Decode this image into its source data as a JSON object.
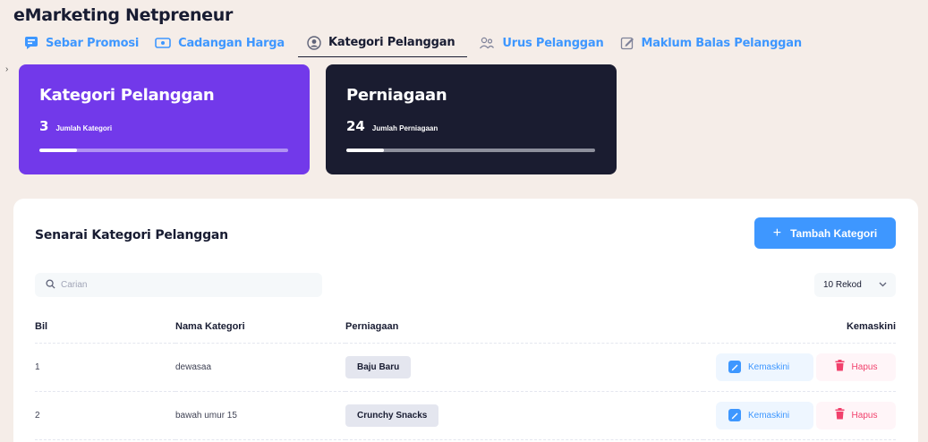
{
  "app": {
    "title": "eMarketing Netpreneur"
  },
  "nav": {
    "items": [
      {
        "label": "Sebar Promosi",
        "icon": "message-icon",
        "active": false
      },
      {
        "label": "Cadangan Harga",
        "icon": "cash-icon",
        "active": false
      },
      {
        "label": "Kategori Pelanggan",
        "icon": "user-circle-icon",
        "active": true
      },
      {
        "label": "Urus Pelanggan",
        "icon": "users-icon",
        "active": false
      },
      {
        "label": "Maklum Balas Pelanggan",
        "icon": "pencil-square-icon",
        "active": false
      }
    ]
  },
  "stats": [
    {
      "title": "Kategori Pelanggan",
      "number": "3",
      "label": "Jumlah Kategori",
      "progress_fraction": 0.15,
      "color": "#7239ea"
    },
    {
      "title": "Perniagaan",
      "number": "24",
      "label": "Jumlah Perniagaan",
      "progress_fraction": 0.15,
      "color": "#1a1c30"
    }
  ],
  "panel": {
    "title": "Senarai Kategori Pelanggan",
    "add_button": {
      "label": "Tambah Kategori",
      "icon": "plus-icon"
    },
    "search": {
      "placeholder": "Carian",
      "icon": "search-icon"
    },
    "page_size": {
      "selected": "10 Rekod",
      "icon": "chevron-down-icon"
    }
  },
  "table": {
    "headers": {
      "bil": "Bil",
      "nama": "Nama Kategori",
      "perniagaan": "Perniagaan",
      "kemaskini": "Kemaskini"
    },
    "rows": [
      {
        "bil": "1",
        "nama": "dewasaa",
        "perniagaan": "Baju Baru"
      },
      {
        "bil": "2",
        "nama": "bawah umur 15",
        "perniagaan": "Crunchy Snacks"
      }
    ],
    "edit_label": "Kemaskini",
    "delete_label": "Hapus"
  },
  "colors": {
    "accent": "#3e97ff",
    "danger": "#f1416c",
    "purple": "#7239ea",
    "dark": "#1a1c30"
  }
}
